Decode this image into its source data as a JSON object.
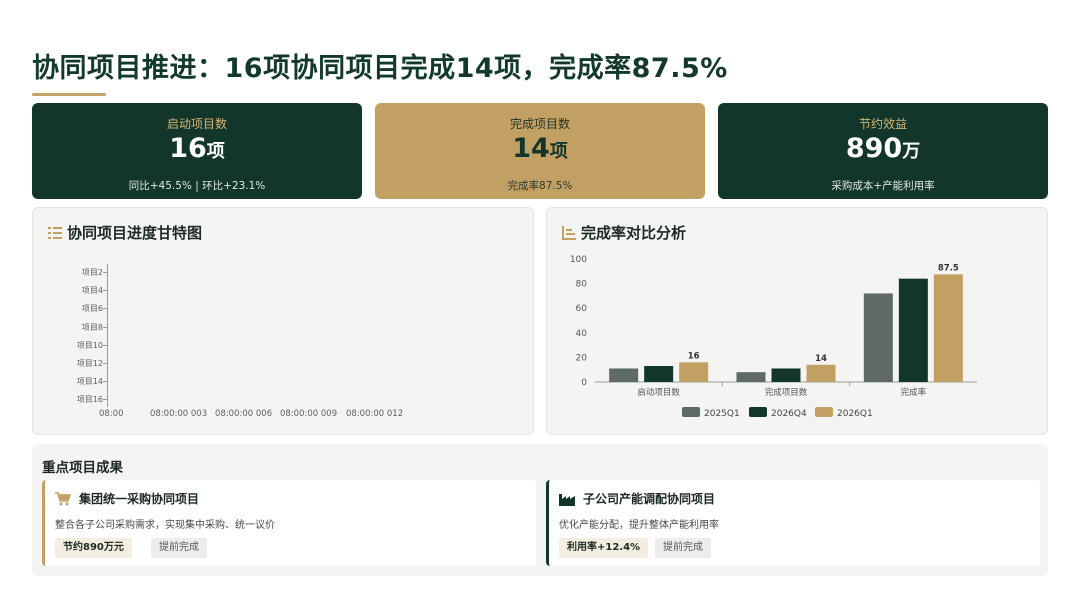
{
  "page": {
    "title": "协同项目推进：16项协同项目完成14项，完成率87.5%"
  },
  "kpis": [
    {
      "label": "启动项目数",
      "value": "16",
      "unit": "项",
      "sub": "同比+45.5% | 环比+23.1%"
    },
    {
      "label": "完成项目数",
      "value": "14",
      "unit": "项",
      "sub": "完成率87.5%"
    },
    {
      "label": "节约效益",
      "value": "890",
      "unit": "万",
      "sub": "采购成本+产能利用率"
    }
  ],
  "gantt": {
    "title": "协同项目进度甘特图",
    "y_labels": [
      "项目2",
      "项目4",
      "项目6",
      "项目8",
      "项目10",
      "项目12",
      "项目14",
      "项目16"
    ],
    "x_labels": [
      "08:00",
      "08:00:00 003",
      "08:00:00 006",
      "08:00:00 009",
      "08:00:00 012"
    ]
  },
  "compare": {
    "title": "完成率对比分析"
  },
  "chart_data": {
    "type": "bar",
    "title": "完成率对比分析",
    "categories": [
      "启动项目数",
      "完成项目数",
      "完成率"
    ],
    "series": [
      {
        "name": "2025Q1",
        "values": [
          11,
          8,
          72
        ],
        "color": "#5e6a63"
      },
      {
        "name": "2026Q4",
        "values": [
          13,
          11,
          84
        ],
        "color": "#12362a"
      },
      {
        "name": "2026Q1",
        "values": [
          16,
          14,
          87.5
        ],
        "color": "#c2a063"
      }
    ],
    "data_labels": {
      "2026Q1": [
        "16",
        "14",
        "87.5"
      ]
    },
    "ylim": [
      0,
      100
    ],
    "yticks": [
      0,
      20,
      40,
      60,
      80,
      100
    ],
    "legend": "bottom",
    "grid": false
  },
  "highlights": {
    "title": "重点项目成果",
    "cards": [
      {
        "icon": "cart-icon",
        "title": "集团统一采购协同项目",
        "desc": "整合各子公司采购需求，实现集中采购、统一议价",
        "tag_main": "节约890万元",
        "tag_status": "提前完成"
      },
      {
        "icon": "factory-icon",
        "title": "子公司产能调配协同项目",
        "desc": "优化产能分配，提升整体产能利用率",
        "tag_main": "利用率+12.4%",
        "tag_status": "提前完成"
      }
    ]
  },
  "colors": {
    "dark": "#12362a",
    "gold": "#c2a063",
    "grey": "#5e6a63"
  }
}
